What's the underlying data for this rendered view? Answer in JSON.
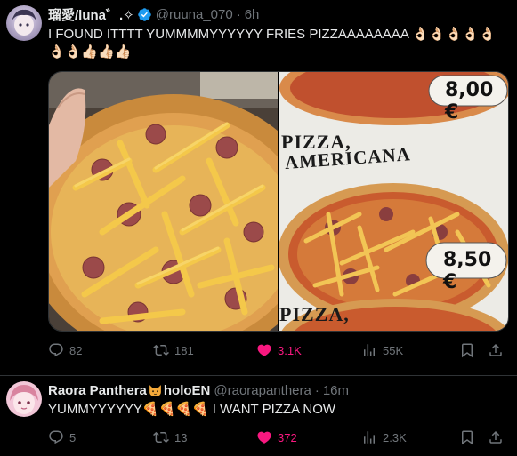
{
  "tweet1": {
    "display_name": "瑠愛/luna゛.✧",
    "handle": "@ruuna_070",
    "separator": "·",
    "time": "6h",
    "text_line1": "I FOUND ITTTT YUMMMMYYYYYY FRIES PIZZAAAAAAAA",
    "emoji_line1": "👌🏻👌🏻👌🏻👌🏻👌🏻",
    "emoji_line2": "👌🏻👌🏻👍🏻👍🏻👍🏻",
    "media": {
      "right_sign_top": "PIZZA,",
      "right_sign_main": "AMERICANA",
      "right_sign_bottom": "PIZZA,",
      "price_top": "8,00 €",
      "price_bottom": "8,50 €"
    },
    "actions": {
      "reply_count": "82",
      "retweet_count": "181",
      "like_count": "3.1K",
      "views_count": "55K"
    }
  },
  "tweet2": {
    "display_name": "Raora Panthera",
    "name_suffix": "holoEN",
    "handle": "@raorapanthera",
    "separator": "·",
    "time": "16m",
    "text_start": "YUMMYYYYYY",
    "pizza_emojis": "🍕🍕🍕🍕",
    "text_end": "I WANT PIZZA NOW",
    "actions": {
      "reply_count": "5",
      "retweet_count": "13",
      "like_count": "372",
      "views_count": "2.3K"
    }
  },
  "colors": {
    "background": "#000000",
    "text_primary": "#e7e9ea",
    "text_secondary": "#71767b",
    "like_active": "#f91880",
    "verified_blue": "#1d9bf0",
    "divider": "#2f3336"
  }
}
